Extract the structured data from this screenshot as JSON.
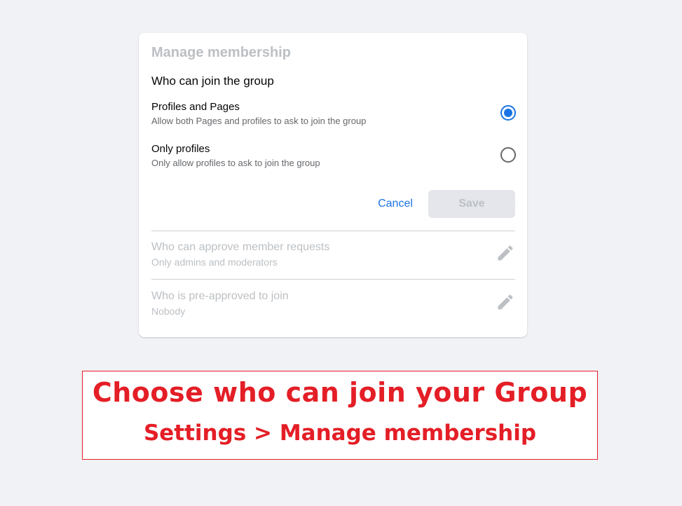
{
  "dialog": {
    "title": "Manage membership",
    "section_title": "Who can join the group",
    "options": [
      {
        "title": "Profiles and Pages",
        "description": "Allow both Pages and profiles to ask to join the group",
        "selected": true
      },
      {
        "title": "Only profiles",
        "description": "Only allow profiles to ask to join the group",
        "selected": false
      }
    ],
    "cancel_label": "Cancel",
    "save_label": "Save",
    "settings": [
      {
        "title": "Who can approve member requests",
        "value": "Only admins and moderators",
        "icon": "pencil-icon"
      },
      {
        "title": "Who is pre-approved to join",
        "value": "Nobody",
        "icon": "pencil-icon"
      }
    ]
  },
  "banner": {
    "headline": "Choose who can join your Group",
    "subline": "Settings > Manage membership"
  },
  "colors": {
    "accent": "#1b74e4",
    "banner_red": "#e41e26",
    "disabled_text": "#bcc0c4",
    "background": "#f0f2f5"
  }
}
